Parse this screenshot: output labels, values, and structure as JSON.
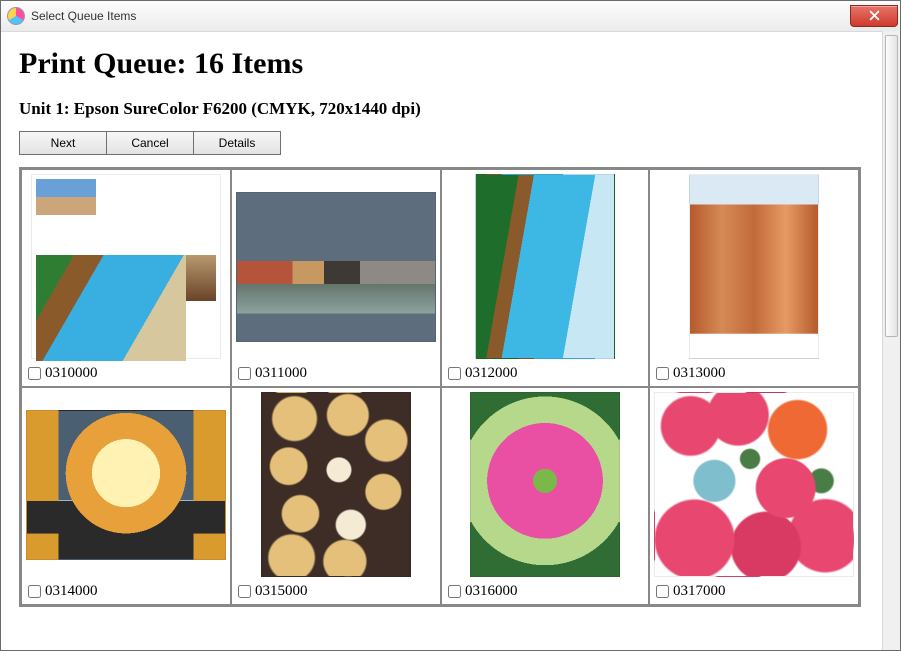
{
  "window": {
    "title": "Select Queue Items"
  },
  "header": {
    "title": "Print Queue: 16 Items",
    "subtitle": "Unit 1: Epson SureColor F6200 (CMYK, 720x1440 dpi)"
  },
  "buttons": {
    "next": "Next",
    "cancel": "Cancel",
    "details": "Details"
  },
  "items": [
    {
      "id": "0310000",
      "checked": false
    },
    {
      "id": "0311000",
      "checked": false
    },
    {
      "id": "0312000",
      "checked": false
    },
    {
      "id": "0313000",
      "checked": false
    },
    {
      "id": "0314000",
      "checked": false
    },
    {
      "id": "0315000",
      "checked": false
    },
    {
      "id": "0316000",
      "checked": false
    },
    {
      "id": "0317000",
      "checked": false
    }
  ]
}
